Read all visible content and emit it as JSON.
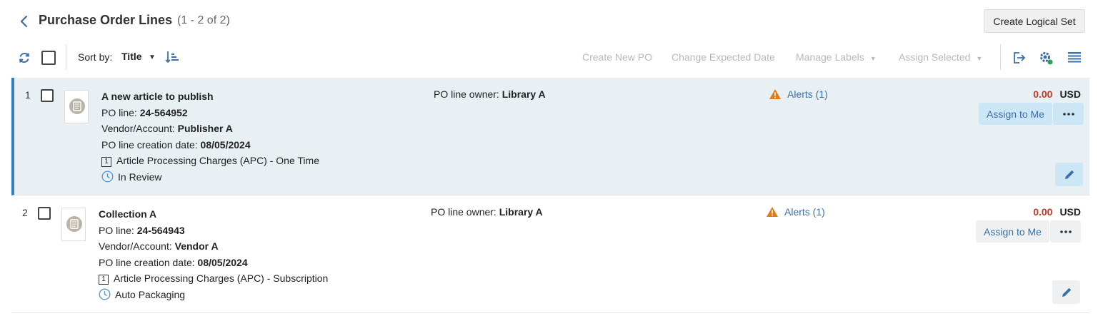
{
  "header": {
    "title": "Purchase Order Lines",
    "count": "(1 - 2 of 2)",
    "create_logical_set": "Create Logical Set"
  },
  "toolbar": {
    "sort_label": "Sort by:",
    "sort_value": "Title",
    "actions": {
      "create_po": "Create New PO",
      "change_date": "Change Expected Date",
      "manage_labels": "Manage Labels",
      "assign_selected": "Assign Selected"
    },
    "icons": [
      "refresh-icon",
      "sort-direction-icon",
      "export-icon",
      "settings-icon",
      "columns-icon"
    ]
  },
  "rows": [
    {
      "num": "1",
      "title": "A new article to publish",
      "po_line_label": "PO line:",
      "po_line": "24-564952",
      "vendor_label": "Vendor/Account:",
      "vendor": "Publisher A",
      "date_label": "PO line creation date:",
      "date": "08/05/2024",
      "type_badge": "1",
      "type": "Article Processing Charges (APC) - One Time",
      "status": "In Review",
      "owner_label": "PO line owner:",
      "owner": "Library A",
      "alerts": "Alerts (1)",
      "amount": "0.00",
      "currency": "USD",
      "assign": "Assign to Me",
      "selected": true
    },
    {
      "num": "2",
      "title": "Collection A",
      "po_line_label": "PO line:",
      "po_line": "24-564943",
      "vendor_label": "Vendor/Account:",
      "vendor": "Vendor A",
      "date_label": "PO line creation date:",
      "date": "08/05/2024",
      "type_badge": "1",
      "type": "Article Processing Charges (APC) - Subscription",
      "status": "Auto Packaging",
      "owner_label": "PO line owner:",
      "owner": "Library A",
      "alerts": "Alerts (1)",
      "amount": "0.00",
      "currency": "USD",
      "assign": "Assign to Me",
      "selected": false
    }
  ],
  "colors": {
    "accent": "#2f80c0",
    "link": "#3a6fa8",
    "amount": "#c0392b",
    "alert": "#e07b1a",
    "selected_row": "#e8f0f3"
  }
}
